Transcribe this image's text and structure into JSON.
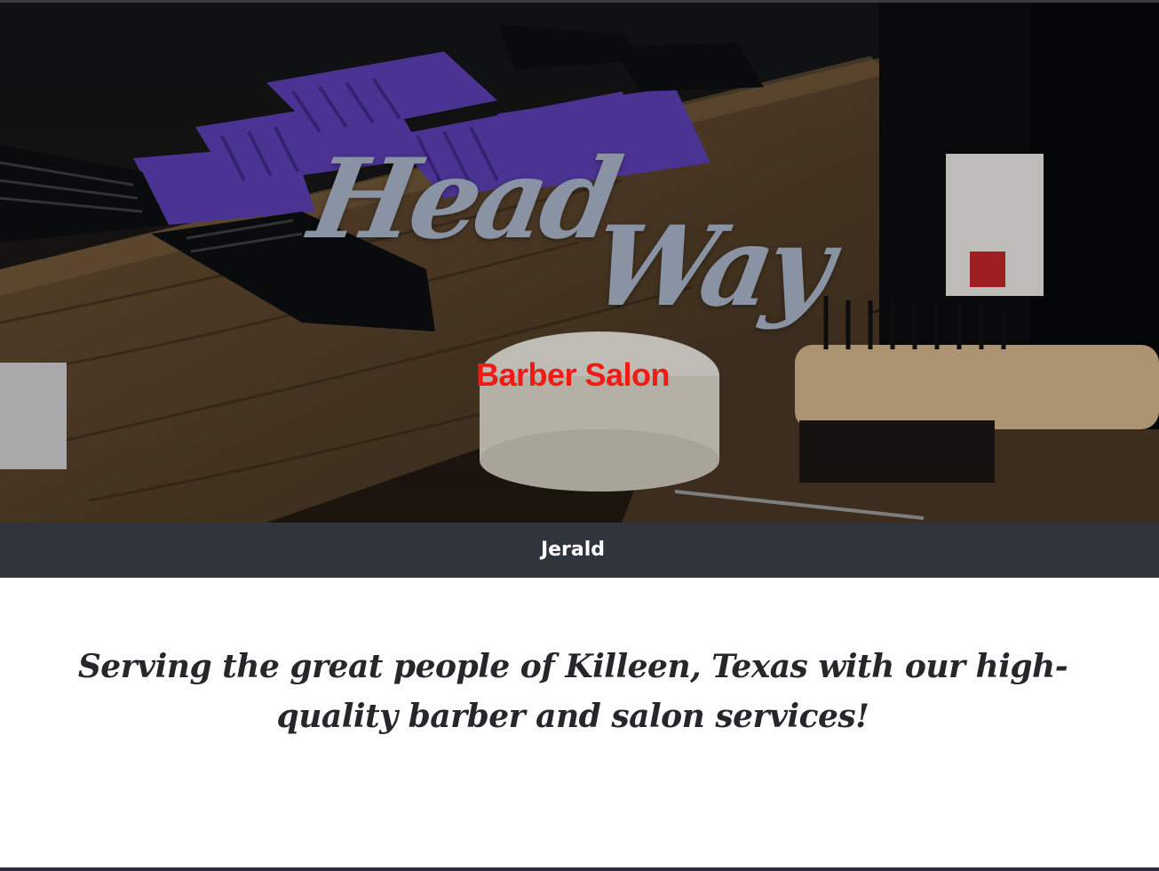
{
  "hero": {
    "logo_line1": "Head",
    "logo_line2": "Way",
    "subtitle": "Barber Salon",
    "background_icon": "barber-tools-photo",
    "colors": {
      "logo": "#8a93a3",
      "subtitle": "#f21a14"
    }
  },
  "nav": {
    "items": [
      {
        "label": "Jerald"
      }
    ],
    "background": "#30343b"
  },
  "main": {
    "tagline": "Serving the great people of Killeen, Texas with our high-quality barber and salon services!"
  }
}
